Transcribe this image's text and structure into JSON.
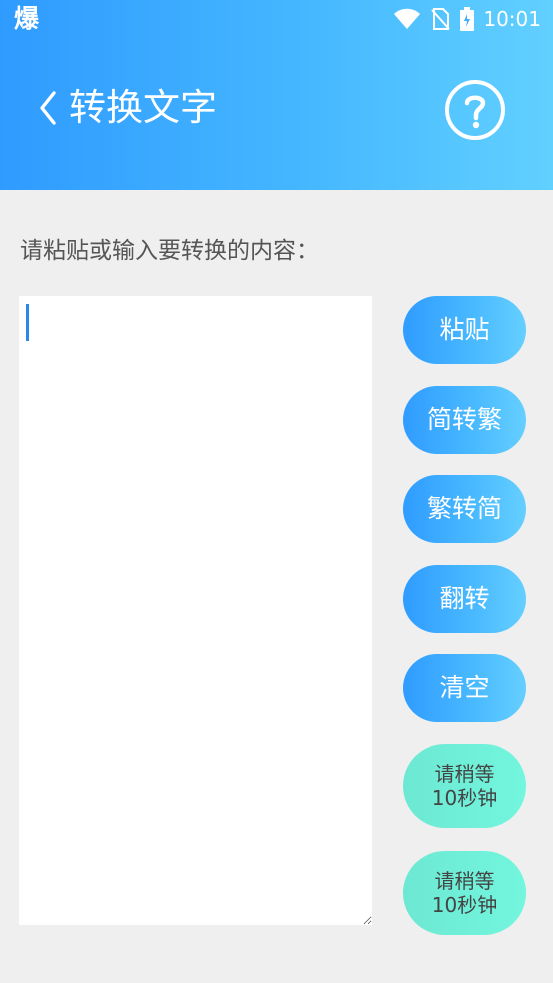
{
  "status_bar": {
    "left_text": "爆",
    "time": "10:01",
    "icons": [
      "wifi-icon",
      "no-sim-icon",
      "battery-charging-icon"
    ]
  },
  "header": {
    "back_icon": "chevron-left-icon",
    "title": "转换文字",
    "help_icon": "question-circle-icon",
    "gradient_from": "#2f9bff",
    "gradient_to": "#61d0ff"
  },
  "main": {
    "prompt": "请粘贴或输入要转换的内容：",
    "editor": {
      "value": "",
      "placeholder": ""
    }
  },
  "actions": {
    "paste": "粘贴",
    "simp_to_trad": "简转繁",
    "trad_to_simp": "繁转简",
    "reverse": "翻转",
    "clear": "清空",
    "wait_1_line1": "请稍等",
    "wait_1_line2": "10秒钟",
    "wait_2_line1": "请稍等",
    "wait_2_line2": "10秒钟"
  },
  "colors": {
    "page_bg": "#efefef",
    "blue_button": "#45b7ff",
    "green_button": "#72f6dd",
    "cursor": "#2b88e9"
  }
}
